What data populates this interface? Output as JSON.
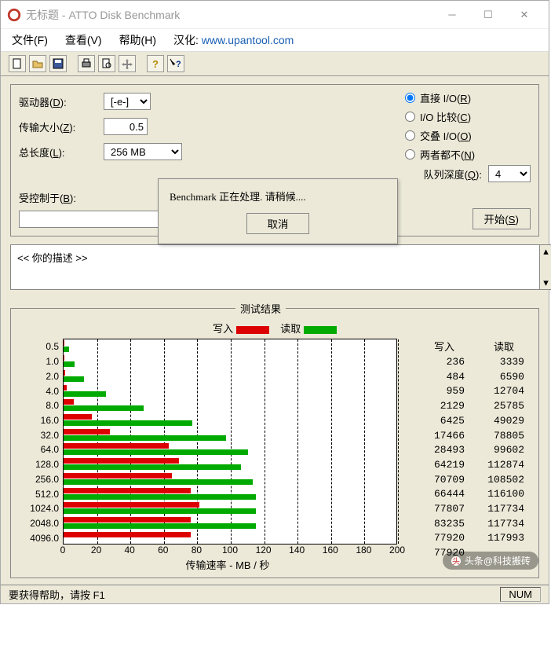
{
  "title": "无标题 - ATTO Disk Benchmark",
  "menus": {
    "file": "文件(F)",
    "view": "查看(V)",
    "help": "帮助(H)",
    "loc_label": "汉化:",
    "loc_link": "www.upantool.com"
  },
  "toolbar_icons": [
    "new",
    "open",
    "save",
    "print",
    "preview",
    "move",
    "help",
    "whatsthis"
  ],
  "params": {
    "drive_label": "驱动器",
    "drive_key": "D",
    "drive_value": "[-e-]",
    "xfer_label": "传输大小",
    "xfer_key": "Z",
    "xfer_value": "0.5",
    "len_label": "总长度",
    "len_key": "L",
    "len_value": "256 MB",
    "radios": {
      "direct": {
        "label": "直接 I/O",
        "key": "R",
        "checked": true
      },
      "compare": {
        "label": "I/O 比较",
        "key": "C",
        "checked": false
      },
      "overlap": {
        "label": "交叠 I/O",
        "key": "O",
        "checked": false
      },
      "neither": {
        "label": "两者都不",
        "key": "N",
        "checked": false
      }
    },
    "qd_label": "队列深度",
    "qd_key": "Q",
    "qd_value": "4",
    "ctrl_label": "受控制于",
    "ctrl_key": "B",
    "start_label": "开始",
    "start_key": "S"
  },
  "desc": "<<  你的描述   >>",
  "dialog": {
    "msg": "Benchmark 正在处理.  请稍候....",
    "cancel": "取消"
  },
  "results": {
    "title": "测试结果",
    "write_label": "写入",
    "read_label": "读取",
    "xlabel": "传输速率 - MB / 秒"
  },
  "chart_data": {
    "type": "bar",
    "xlabel": "传输速率 - MB / 秒",
    "xlim": [
      0,
      200
    ],
    "xticks": [
      0,
      20,
      40,
      60,
      80,
      100,
      120,
      140,
      160,
      180,
      200
    ],
    "categories": [
      "0.5",
      "1.0",
      "2.0",
      "4.0",
      "8.0",
      "16.0",
      "32.0",
      "64.0",
      "128.0",
      "256.0",
      "512.0",
      "1024.0",
      "2048.0",
      "4096.0"
    ],
    "series": [
      {
        "name": "写入",
        "color": "#d00",
        "values_kb": [
          236,
          484,
          959,
          2129,
          6425,
          17466,
          28493,
          64219,
          70709,
          66444,
          77807,
          83235,
          77920,
          77920
        ]
      },
      {
        "name": "读取",
        "color": "#0a0",
        "values_kb": [
          3339,
          6590,
          12704,
          25785,
          49029,
          78805,
          99602,
          112874,
          108502,
          116100,
          117734,
          117734,
          117993,
          null
        ]
      }
    ]
  },
  "status": {
    "help": "要获得帮助，请按 F1",
    "num": "NUM"
  },
  "watermark": "头条@科技搬砖"
}
